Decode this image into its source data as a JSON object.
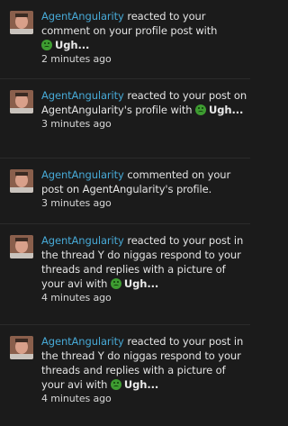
{
  "notifications": [
    {
      "user": "AgentAngularity",
      "text": " reacted to your comment on your profile post with ",
      "reaction": "Ugh...",
      "time": "2 minutes ago"
    },
    {
      "user": "AgentAngularity",
      "text": " reacted to your post on AgentAngularity's profile with ",
      "reaction": "Ugh...",
      "time": "3 minutes ago"
    },
    {
      "user": "AgentAngularity",
      "text": " commented on your post on AgentAngularity's profile.",
      "reaction": "",
      "time": "3 minutes ago"
    },
    {
      "user": "AgentAngularity",
      "text": " reacted to your post in the thread ",
      "thread": "Y do niggas respond to your threads and replies with a picture of your avi",
      "text2": " with ",
      "reaction": "Ugh...",
      "time": "4 minutes ago"
    },
    {
      "user": "AgentAngularity",
      "text": " reacted to your post in the thread ",
      "thread": "Y do niggas respond to your threads and replies with a picture of your avi",
      "text2": " with ",
      "reaction": "Ugh...",
      "time": "4 minutes ago"
    }
  ],
  "reaction_icon": "sick-face-icon",
  "colors": {
    "background": "#1b1b1b",
    "username": "#47a9d6",
    "reaction_emoji": "#3e9c31"
  }
}
